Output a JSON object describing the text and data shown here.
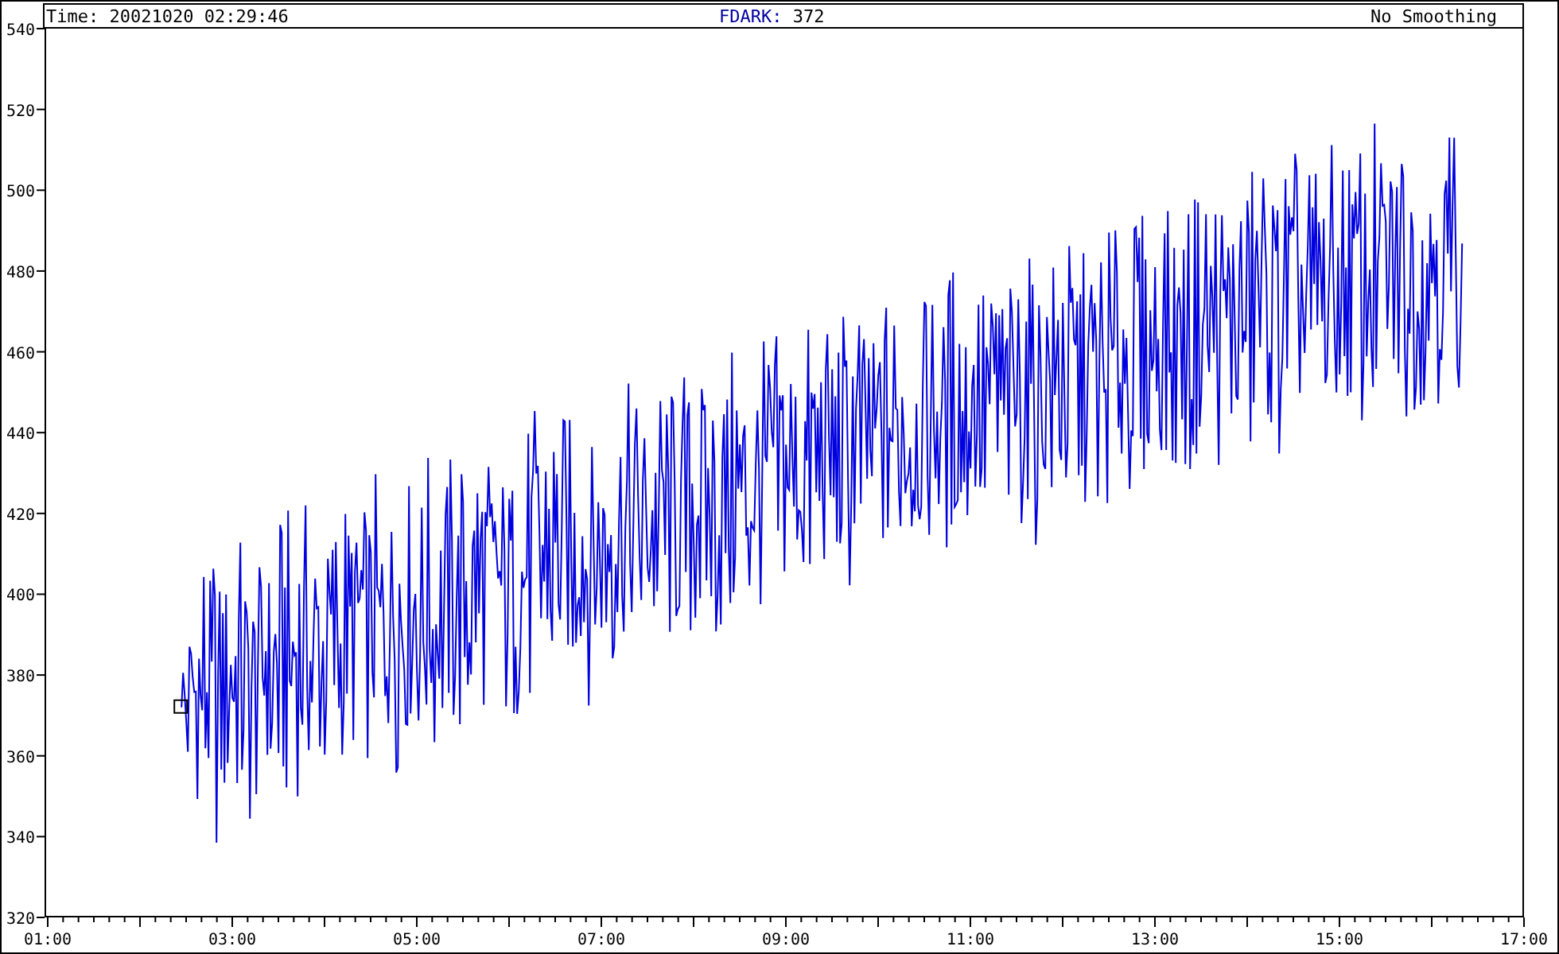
{
  "header": {
    "time": "Time: 20021020 02:29:46",
    "channel_label": "FDARK:",
    "channel_value": "372",
    "smoothing": "No Smoothing"
  },
  "plot": {
    "y_labels": [
      "540",
      "520",
      "500",
      "480",
      "460",
      "440",
      "420",
      "400",
      "380",
      "360",
      "340",
      "320"
    ],
    "x_labels": [
      "01:00",
      "03:00",
      "05:00",
      "07:00",
      "09:00",
      "11:00",
      "13:00",
      "15:00",
      "17:00"
    ]
  }
}
